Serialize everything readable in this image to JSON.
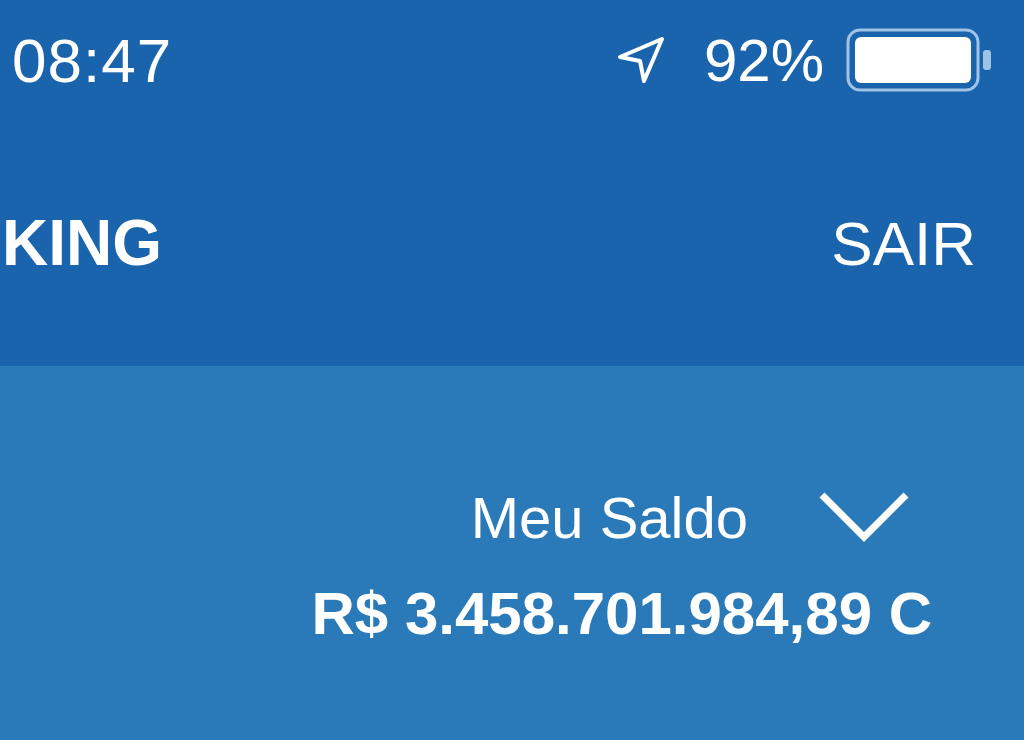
{
  "status_bar": {
    "time": "08:47",
    "battery_text": "92%"
  },
  "header": {
    "title": "KING",
    "action": "SAIR"
  },
  "balance": {
    "label": "Meu Saldo",
    "amount": "R$ 3.458.701.984,89 C",
    "expanded": false
  }
}
